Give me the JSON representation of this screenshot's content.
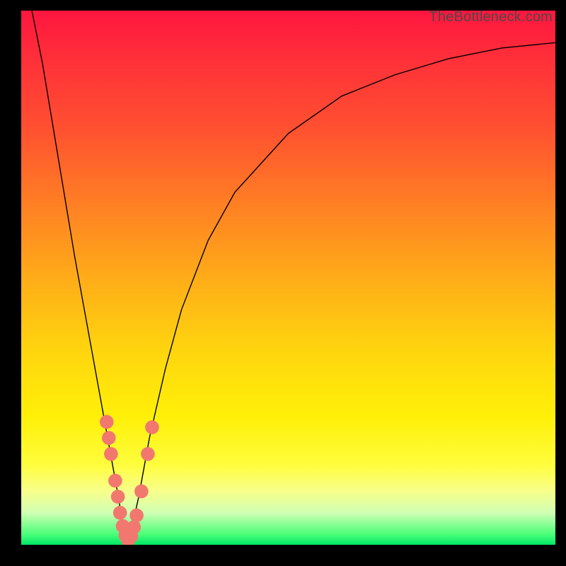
{
  "watermark": "TheBottleneck.com",
  "chart_data": {
    "type": "line",
    "title": "",
    "xlabel": "",
    "ylabel": "",
    "xlim": [
      0,
      100
    ],
    "ylim": [
      0,
      100
    ],
    "grid": false,
    "legend": false,
    "background_gradient": {
      "direction": "vertical",
      "stops": [
        {
          "pos": 0.0,
          "color": "#ff153f"
        },
        {
          "pos": 0.22,
          "color": "#ff5030"
        },
        {
          "pos": 0.52,
          "color": "#ffb217"
        },
        {
          "pos": 0.76,
          "color": "#fff008"
        },
        {
          "pos": 0.94,
          "color": "#d0ffb3"
        },
        {
          "pos": 1.0,
          "color": "#00e765"
        }
      ]
    },
    "series": [
      {
        "name": "curve-left",
        "color": "#000000",
        "x": [
          2,
          4,
          6,
          8,
          10,
          12,
          14,
          16,
          18,
          19,
          20
        ],
        "y": [
          100,
          90,
          78,
          66,
          54,
          43,
          32,
          21,
          10,
          4,
          0
        ]
      },
      {
        "name": "curve-right",
        "color": "#000000",
        "x": [
          20,
          22,
          24,
          27,
          30,
          35,
          40,
          50,
          60,
          70,
          80,
          90,
          100
        ],
        "y": [
          0,
          9,
          20,
          33,
          44,
          57,
          66,
          77,
          84,
          88,
          91,
          93,
          94
        ]
      },
      {
        "name": "markers",
        "type": "scatter",
        "color": "#f2786f",
        "points": [
          {
            "x": 16.0,
            "y": 23
          },
          {
            "x": 16.4,
            "y": 20
          },
          {
            "x": 16.8,
            "y": 17
          },
          {
            "x": 17.6,
            "y": 12
          },
          {
            "x": 18.1,
            "y": 9
          },
          {
            "x": 18.5,
            "y": 6
          },
          {
            "x": 19.0,
            "y": 3.5
          },
          {
            "x": 19.5,
            "y": 1.8
          },
          {
            "x": 20.0,
            "y": 0.8
          },
          {
            "x": 20.6,
            "y": 1.6
          },
          {
            "x": 21.1,
            "y": 3.3
          },
          {
            "x": 21.6,
            "y": 5.5
          },
          {
            "x": 22.5,
            "y": 10
          },
          {
            "x": 23.7,
            "y": 17
          },
          {
            "x": 24.5,
            "y": 22
          }
        ]
      }
    ]
  }
}
